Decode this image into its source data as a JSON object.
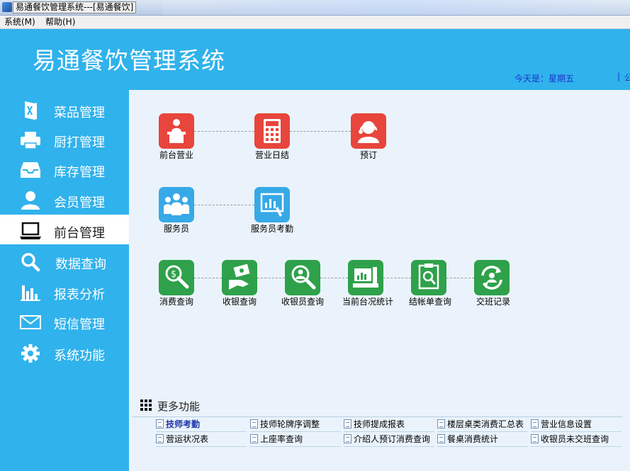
{
  "window": {
    "title": "易通餐饮管理系统---[易通餐饮]"
  },
  "menu": [
    {
      "label": "系统(M)"
    },
    {
      "label": "帮助(H)"
    }
  ],
  "header": {
    "app_title": "易通餐饮管理系统",
    "today_label": "今天是：星期五",
    "today_sep": "|",
    "today_extra": "公"
  },
  "sidebar": {
    "items": [
      {
        "label": "菜品管理",
        "icon": "menu-book-icon"
      },
      {
        "label": "厨打管理",
        "icon": "printer-icon"
      },
      {
        "label": "库存管理",
        "icon": "inbox-icon"
      },
      {
        "label": "会员管理",
        "icon": "user-icon"
      },
      {
        "label": "前台管理",
        "icon": "laptop-icon",
        "active": true
      },
      {
        "label": "数据查询",
        "icon": "search-icon"
      },
      {
        "label": "报表分析",
        "icon": "bar-chart-icon"
      },
      {
        "label": "短信管理",
        "icon": "envelope-icon"
      },
      {
        "label": "系统功能",
        "icon": "gear-icon"
      }
    ]
  },
  "tiles": {
    "row1": [
      {
        "label": "前台营业",
        "color": "red",
        "icon": "reception-desk-icon"
      },
      {
        "label": "营业日结",
        "color": "red",
        "icon": "calculator-icon"
      },
      {
        "label": "预订",
        "color": "red",
        "icon": "phone-operator-icon"
      }
    ],
    "row2": [
      {
        "label": "服务员",
        "color": "blue",
        "icon": "staff-group-icon"
      },
      {
        "label": "服务员考勤",
        "color": "blue",
        "icon": "attendance-chart-icon"
      }
    ],
    "row3": [
      {
        "label": "消费查询",
        "color": "green",
        "icon": "money-search-icon"
      },
      {
        "label": "收银查询",
        "color": "green",
        "icon": "cash-hand-icon"
      },
      {
        "label": "收银员查询",
        "color": "green",
        "icon": "cashier-search-icon"
      },
      {
        "label": "当前台况统计",
        "color": "green",
        "icon": "register-stats-icon"
      },
      {
        "label": "结帐单查询",
        "color": "green",
        "icon": "bill-search-icon"
      },
      {
        "label": "交班记录",
        "color": "green",
        "icon": "shift-exchange-icon"
      }
    ]
  },
  "more": {
    "title": "更多功能",
    "links": [
      {
        "label": "技师考勤",
        "bold": true
      },
      {
        "label": "技师轮牌序调整"
      },
      {
        "label": "技师提成报表"
      },
      {
        "label": "楼层桌类消费汇总表"
      },
      {
        "label": "营业信息设置"
      },
      {
        "label": "营运状况表"
      },
      {
        "label": "上座率查询"
      },
      {
        "label": "介绍人预订消费查询"
      },
      {
        "label": "餐桌消费统计"
      },
      {
        "label": "收银员未交班查询"
      }
    ]
  },
  "colors": {
    "header_blue": "#30b2ec",
    "tile_red": "#e8453c",
    "tile_blue": "#37a9e7",
    "tile_green": "#2ea14a"
  }
}
